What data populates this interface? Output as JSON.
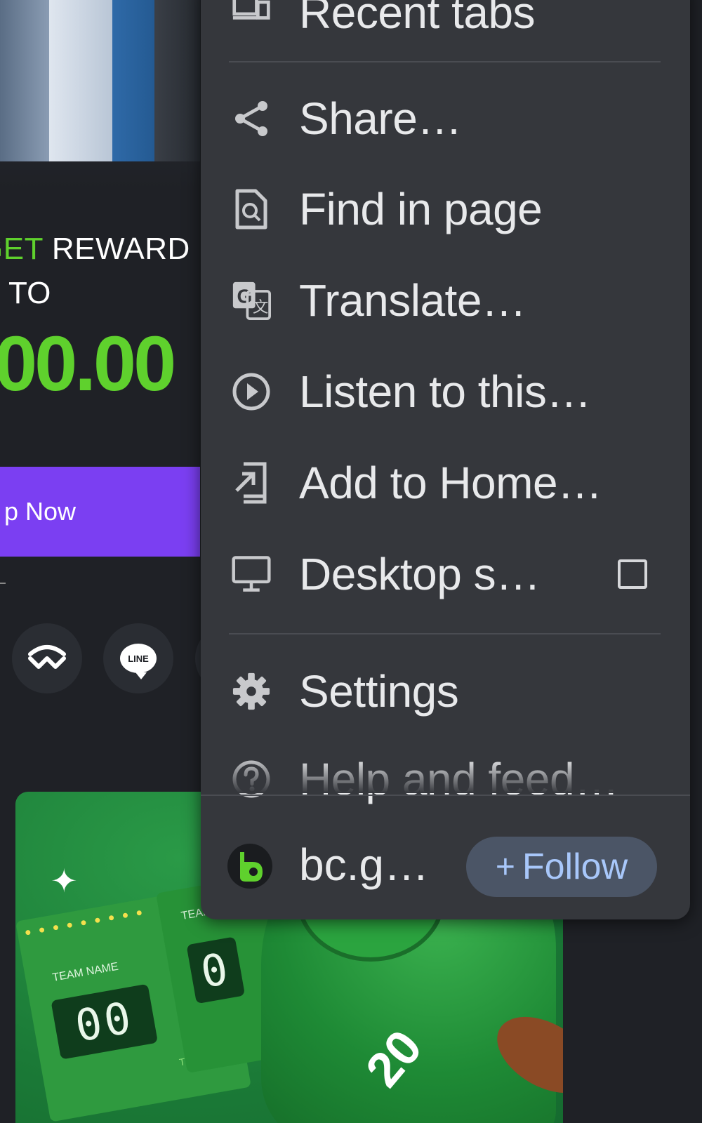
{
  "background_page": {
    "promo": {
      "line1_highlight": "GET",
      "line1_rest": "REWARD",
      "line2": "TO",
      "amount": "00.00"
    },
    "signup_button_label": "p Now",
    "social_line_text": "LINE",
    "game_card": {
      "team_name": "TEAM NAME",
      "team_partial": "TEAM",
      "score": "00",
      "score_partial": "0",
      "time_label": "TIME",
      "jersey_number": "20"
    }
  },
  "menu": {
    "items": [
      {
        "label": "Recent tabs",
        "icon": "recent-tabs-icon"
      },
      {
        "label": "Share…",
        "icon": "share-icon"
      },
      {
        "label": "Find in page",
        "icon": "find-in-page-icon"
      },
      {
        "label": "Translate…",
        "icon": "translate-icon"
      },
      {
        "label": "Listen to this…",
        "icon": "play-circle-icon"
      },
      {
        "label": "Add to Home…",
        "icon": "add-to-home-icon"
      },
      {
        "label": "Desktop s…",
        "icon": "desktop-icon"
      },
      {
        "label": "Settings",
        "icon": "gear-icon"
      },
      {
        "label": "Help and feed…",
        "icon": "help-icon"
      }
    ],
    "desktop_site_checked": false,
    "footer": {
      "site_label": "bc.g…",
      "follow_plus": "+",
      "follow_label": "Follow"
    }
  },
  "colors": {
    "menu_bg": "#35373c",
    "accent_green": "#5fd12d",
    "signup_purple": "#7b3ff2",
    "follow_text": "#a8c7fa"
  }
}
